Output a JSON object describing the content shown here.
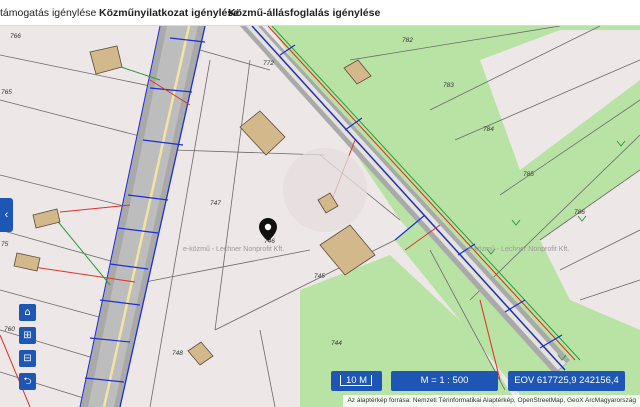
{
  "tabs": [
    {
      "label": "támogatás igénylése",
      "active": false
    },
    {
      "label": "Közműnyilatkozat igénylése",
      "active": true
    },
    {
      "label": "Közmű-állásfoglalás igénylése",
      "active": false
    }
  ],
  "side_toggle": {
    "icon": "chevron-left-icon",
    "glyph": "‹"
  },
  "map_controls": [
    {
      "name": "home-button",
      "icon": "home-icon",
      "glyph": "⌂"
    },
    {
      "name": "zoom-in-button",
      "icon": "plus-icon",
      "glyph": "⊞"
    },
    {
      "name": "zoom-out-button",
      "icon": "minus-icon",
      "glyph": "⊟"
    },
    {
      "name": "back-button",
      "icon": "return-icon",
      "glyph": "⮌"
    }
  ],
  "status": {
    "scale_bar": "10 M",
    "scale_ratio": "M = 1 : 500",
    "coordinates": "EOV  617725,9   242156,4"
  },
  "attribution": "Az alaptérkép forrása: Nemzeti Térinformatikai Alaptérkép, OpenStreetMap, GeoX ArcMagyarország",
  "watermark": "e-közmű - Lechner Nonprofit Kft.",
  "parcel_labels": [
    "766",
    "765",
    "772",
    "782",
    "783",
    "784",
    "785",
    "786",
    "747",
    "746",
    "745",
    "744",
    "748",
    "760",
    "75"
  ],
  "colors": {
    "accent": "#1e56b5",
    "parcel_fill": "#ede7e7",
    "green_area": "#b9e3a5",
    "road_fill": "#a9a9a9",
    "utility_blue": "#1b2fd6",
    "utility_red": "#e0302a",
    "utility_green": "#2d9b3a",
    "building_fill": "#d3b88c"
  },
  "marker": {
    "icon": "map-pin-icon"
  }
}
